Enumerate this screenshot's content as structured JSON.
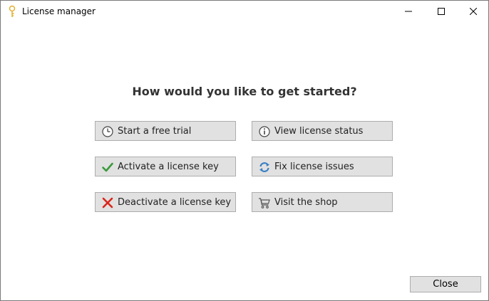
{
  "window": {
    "title": "License manager"
  },
  "main": {
    "heading": "How would you like to get started?",
    "buttons": [
      {
        "label": "Start a free trial",
        "icon": "clock-icon"
      },
      {
        "label": "View license status",
        "icon": "info-icon"
      },
      {
        "label": "Activate a license key",
        "icon": "checkmark-icon",
        "icon_color": "#3c9a3c"
      },
      {
        "label": "Fix license issues",
        "icon": "refresh-icon",
        "icon_color": "#3a7fc4"
      },
      {
        "label": "Deactivate a license key",
        "icon": "x-icon",
        "icon_color": "#d9261c"
      },
      {
        "label": "Visit the shop",
        "icon": "cart-icon"
      }
    ]
  },
  "footer": {
    "close_label": "Close"
  }
}
